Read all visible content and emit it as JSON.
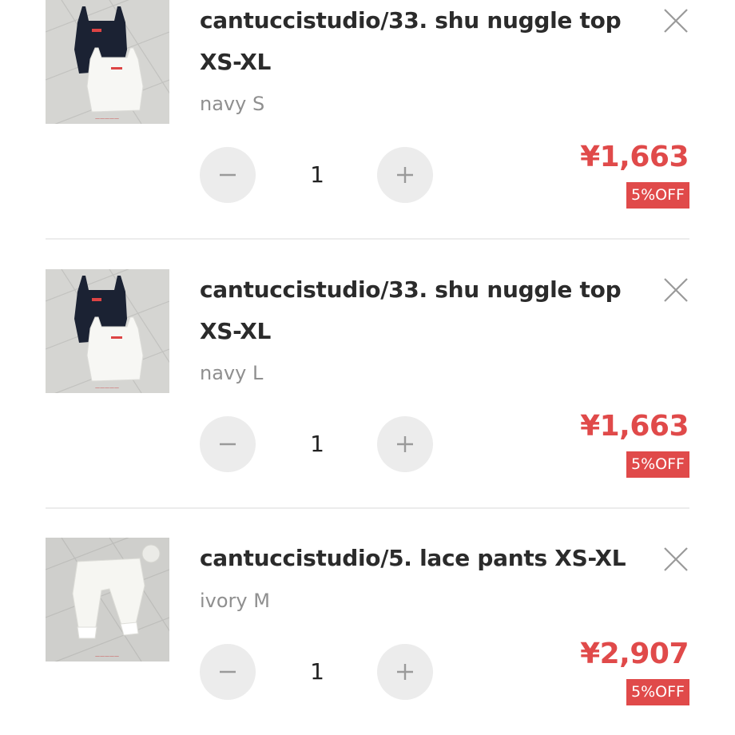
{
  "cart": {
    "items": [
      {
        "title": "cantuccistudio/33. shu nuggle top XS-XL",
        "variant": "navy S",
        "quantity": "1",
        "price": "¥1,663",
        "discount": "5%OFF",
        "thumbnail_icon": "product-photo-tops"
      },
      {
        "title": "cantuccistudio/33. shu nuggle top XS-XL",
        "variant": "navy L",
        "quantity": "1",
        "price": "¥1,663",
        "discount": "5%OFF",
        "thumbnail_icon": "product-photo-tops"
      },
      {
        "title": "cantuccistudio/5. lace pants XS-XL",
        "variant": "ivory M",
        "quantity": "1",
        "price": "¥2,907",
        "discount": "5%OFF",
        "thumbnail_icon": "product-photo-pants"
      }
    ],
    "icons": {
      "remove": "close-icon",
      "decrease": "minus-icon",
      "increase": "plus-icon"
    },
    "colors": {
      "price": "#e04a4a",
      "badge_bg": "#e04a4a",
      "badge_text": "#ffffff",
      "qty_button_bg": "#ececec",
      "variant_text": "#8f8f8f",
      "divider": "#ececec"
    }
  }
}
